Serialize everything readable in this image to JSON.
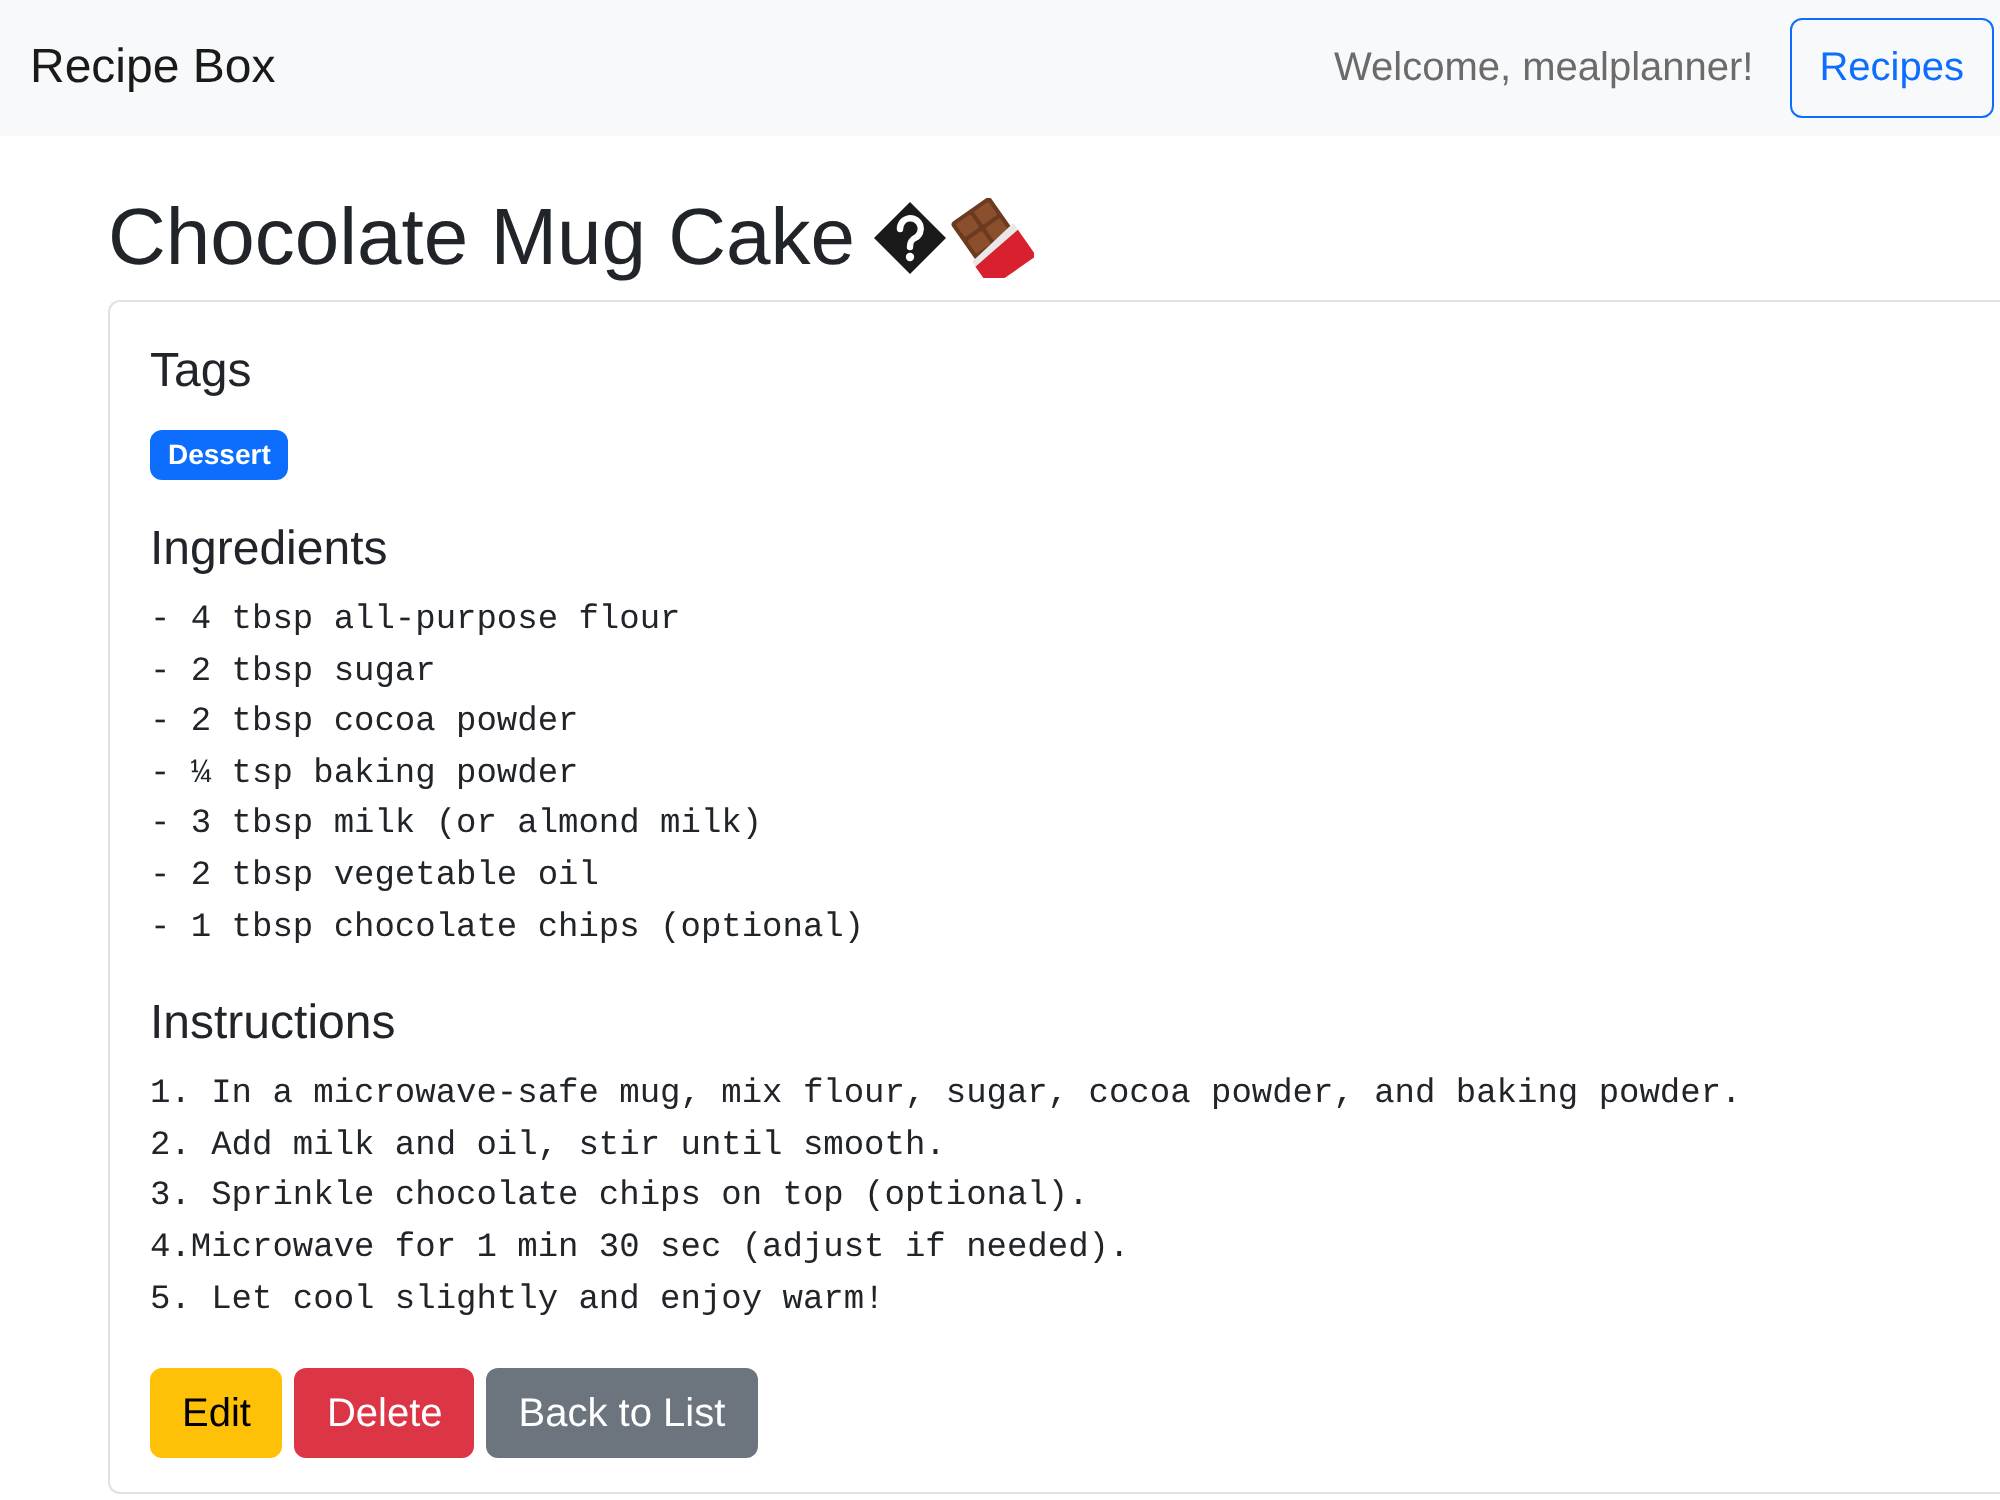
{
  "navbar": {
    "brand": "Recipe Box",
    "welcome": "Welcome, mealplanner!",
    "button": "Recipes"
  },
  "recipe": {
    "title": "Chocolate Mug Cake"
  },
  "sections": [
    {
      "heading": "Tags",
      "kind": "tags",
      "tags": [
        "Dessert"
      ]
    },
    {
      "heading": "Ingredients",
      "kind": "lines",
      "lines": [
        "- 4 tbsp all-purpose flour",
        "- 2 tbsp sugar",
        "- 2 tbsp cocoa powder",
        "- ¼ tsp baking powder",
        "- 3 tbsp milk (or almond milk)",
        "- 2 tbsp vegetable oil",
        "- 1 tbsp chocolate chips (optional)"
      ]
    },
    {
      "heading": "Instructions",
      "kind": "lines",
      "lines": [
        "1. In a microwave-safe mug, mix flour, sugar, cocoa powder, and baking powder.",
        "2. Add milk and oil, stir until smooth.",
        "3. Sprinkle chocolate chips on top (optional).",
        "4.Microwave for 1 min 30 sec (adjust if needed).",
        "5. Let cool slightly and enjoy warm!"
      ]
    }
  ],
  "buttons": [
    {
      "label": "Edit",
      "kind": "warning"
    },
    {
      "label": "Delete",
      "kind": "danger"
    },
    {
      "label": "Back to List",
      "kind": "secondary"
    }
  ]
}
